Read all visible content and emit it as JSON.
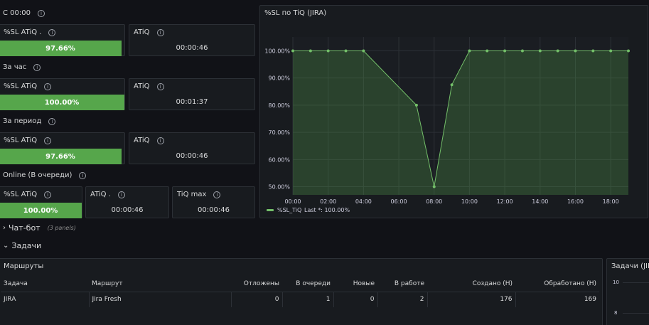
{
  "sections": {
    "since_midnight": "С 00:00",
    "per_hour": "За час",
    "per_period": "За период",
    "online": "Online (В очереди)"
  },
  "stats": {
    "s1_sl_title": "%SL ATiQ .",
    "s1_sl_value": "97.66%",
    "s1_sl_fill": 0.9766,
    "s1_atiq_title": "ATiQ",
    "s1_atiq_value": "00:00:46",
    "s2_sl_title": "%SL ATiQ",
    "s2_sl_value": "100.00%",
    "s2_sl_fill": 1.0,
    "s2_atiq_title": "ATiQ",
    "s2_atiq_value": "00:01:37",
    "s3_sl_title": "%SL ATiQ",
    "s3_sl_value": "97.66%",
    "s3_sl_fill": 0.9766,
    "s3_atiq_title": "ATiQ",
    "s3_atiq_value": "00:00:46",
    "s4_sl_title": "%SL ATiQ",
    "s4_sl_value": "100.00%",
    "s4_sl_fill": 1.0,
    "s4_atiq_title": "ATiQ .",
    "s4_atiq_value": "00:00:46",
    "s4_tiqmax_title": "TiQ max",
    "s4_tiqmax_value": "00:00:46"
  },
  "rows": {
    "chatbot": "Чат-бот",
    "chatbot_sub": "(3 panels)",
    "tasks": "Задачи"
  },
  "routes": {
    "title": "Маршруты",
    "columns": [
      "Задача",
      "Маршрут",
      "Отложены",
      "В очереди",
      "Новые",
      "В работе",
      "Создано (Н)",
      "Обработано (Н)"
    ],
    "row": [
      "JIRA",
      "Jira Fresh",
      "0",
      "1",
      "0",
      "2",
      "176",
      "169"
    ]
  },
  "right_panel": {
    "title": "Задачи (JIR",
    "ticks": [
      "10",
      "8"
    ]
  },
  "colors": {
    "bg": "#111217",
    "panel": "#181b1f",
    "accent_green": "#56a64b",
    "line_green": "#73bf69"
  },
  "chart_data": {
    "type": "area",
    "title": "%SL по TiQ (JIRA)",
    "x": [
      "00:00",
      "01:00",
      "02:00",
      "03:00",
      "04:00",
      "07:00",
      "08:00",
      "09:00",
      "10:00",
      "11:00",
      "12:00",
      "13:00",
      "14:00",
      "15:00",
      "16:00",
      "17:00",
      "18:00",
      "19:00"
    ],
    "x_ticks": [
      "00:00",
      "02:00",
      "04:00",
      "06:00",
      "08:00",
      "10:00",
      "12:00",
      "14:00",
      "16:00",
      "18:00"
    ],
    "y_ticks": [
      "100.00%",
      "90.00%",
      "80.00%",
      "70.00%",
      "60.00%",
      "50.00%"
    ],
    "ylim": [
      47,
      103
    ],
    "series": [
      {
        "name": "%SL_TiQ",
        "values": [
          100,
          100,
          100,
          100,
          100,
          80,
          50,
          87.5,
          100,
          100,
          100,
          100,
          100,
          100,
          100,
          100,
          100,
          100
        ]
      }
    ],
    "legend": "%SL_TiQ",
    "legend_last": "Last *: 100.00%",
    "legend_position": "bottom-left",
    "grid": true
  }
}
